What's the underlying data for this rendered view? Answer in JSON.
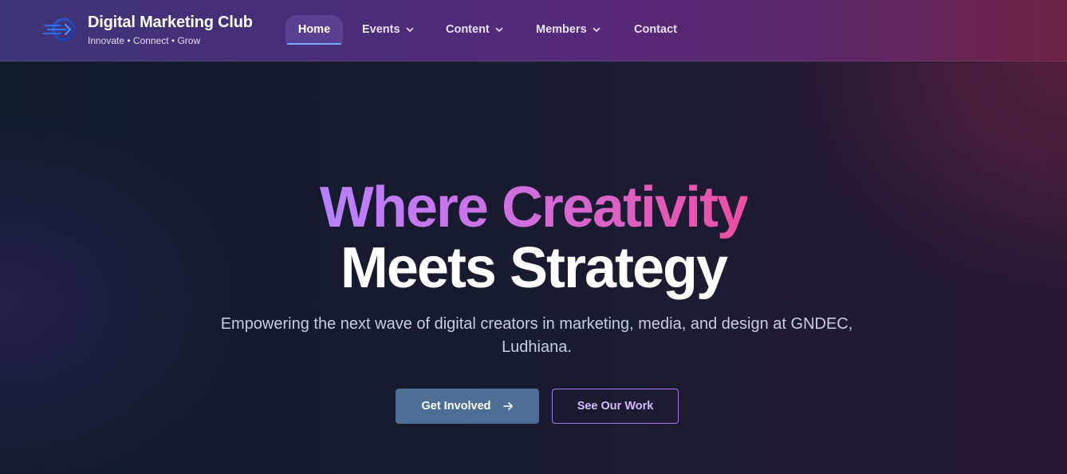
{
  "header": {
    "brand_title": "Digital Marketing Club",
    "brand_tagline": "Innovate • Connect • Grow",
    "logo_icon": "globe-arrow-logo",
    "nav": [
      {
        "label": "Home",
        "active": true,
        "has_dropdown": false
      },
      {
        "label": "Events",
        "active": false,
        "has_dropdown": true
      },
      {
        "label": "Content",
        "active": false,
        "has_dropdown": true
      },
      {
        "label": "Members",
        "active": false,
        "has_dropdown": true
      },
      {
        "label": "Contact",
        "active": false,
        "has_dropdown": false
      }
    ]
  },
  "hero": {
    "headline_gradient": "Where Creativity",
    "headline_plain": "Meets Strategy",
    "subtitle": "Empowering the next wave of digital creators in marketing, media, and design at GNDEC, Ludhiana.",
    "primary_button": "Get Involved",
    "primary_button_icon": "arrow-right-icon",
    "secondary_button": "See Our Work"
  },
  "colors": {
    "headline_gradient_start": "#b782ff",
    "headline_gradient_end": "#ec4fa2",
    "primary_button_bg": "#4e6f95",
    "secondary_button_border": "#a57ae6",
    "nav_active_underline": "#79a8ff"
  }
}
